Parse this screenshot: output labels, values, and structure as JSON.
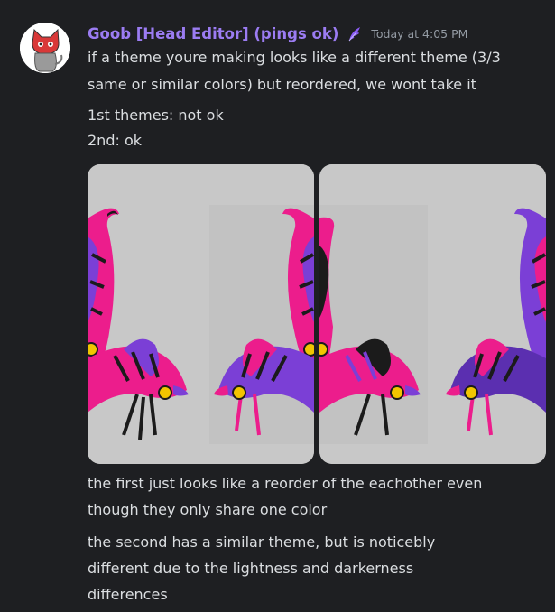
{
  "message": {
    "username": "Goob [Head Editor] (pings ok)",
    "username_color": "#9b7cf2",
    "timestamp": "Today at 4:05 PM",
    "role_icon": "purple-feather-icon",
    "lines": [
      "if a theme youre making looks like a different theme (3/3",
      "same or similar colors) but reordered, we wont take it",
      "1st themes: not ok",
      "2nd: ok"
    ],
    "caption_lines": [
      "the first just looks like a reorder of the eachother even",
      "though they only share one color",
      "the second has a similar theme, but is noticebly",
      "different due to the lightness and darkerness",
      "differences"
    ]
  },
  "attachments": [
    {
      "name": "attachment-1",
      "palette": [
        "#ec1d8c",
        "#7b3fd6",
        "#1b1b1b",
        "#f2c500"
      ]
    },
    {
      "name": "attachment-2",
      "palette": [
        "#ec1d8c",
        "#7b3fd6",
        "#1b1b1b",
        "#f2c500"
      ]
    }
  ],
  "colors": {
    "background": "#1e1f22",
    "text": "#dbdee1",
    "muted": "#949ba4"
  }
}
